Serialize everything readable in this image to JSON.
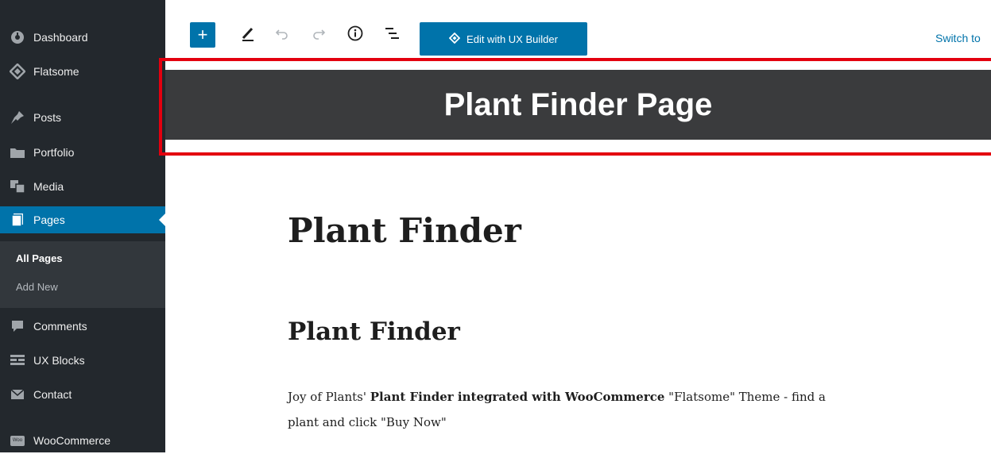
{
  "sidebar": {
    "items": [
      {
        "label": "Dashboard",
        "icon": "dashboard-icon"
      },
      {
        "label": "Flatsome",
        "icon": "flatsome-icon"
      },
      {
        "label": "Posts",
        "icon": "pin-icon"
      },
      {
        "label": "Portfolio",
        "icon": "folder-icon"
      },
      {
        "label": "Media",
        "icon": "media-icon"
      },
      {
        "label": "Pages",
        "icon": "pages-icon",
        "active": true
      },
      {
        "label": "Comments",
        "icon": "comment-icon"
      },
      {
        "label": "UX Blocks",
        "icon": "blocks-icon"
      },
      {
        "label": "Contact",
        "icon": "envelope-icon"
      },
      {
        "label": "WooCommerce",
        "icon": "woocommerce-icon"
      }
    ],
    "submenu": [
      {
        "label": "All Pages",
        "current": true
      },
      {
        "label": "Add New"
      }
    ],
    "woo_badge": "Woo"
  },
  "toolbar": {
    "add_label": "+",
    "ux_builder_label": "Edit with UX Builder",
    "switch_label": "Switch to"
  },
  "banner": {
    "title": "Plant Finder Page"
  },
  "content": {
    "title": "Plant Finder",
    "heading": "Plant Finder",
    "paragraph": {
      "text1": "Joy of Plants' ",
      "bold1": "Plant Finder integrated with WooCommerce",
      "text2": " \"Flatsome\" Theme - find a plant and click \"Buy Now\""
    }
  },
  "colors": {
    "sidebar_bg": "#23282d",
    "submenu_bg": "#32373c",
    "accent": "#0073aa",
    "banner_bg": "#3a3b3d",
    "highlight": "#e3000f"
  }
}
